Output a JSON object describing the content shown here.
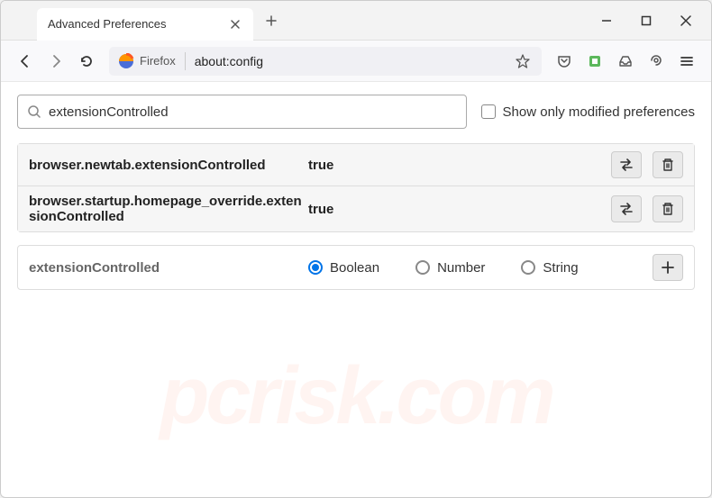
{
  "window": {
    "tab_title": "Advanced Preferences"
  },
  "toolbar": {
    "firefox_label": "Firefox",
    "url": "about:config"
  },
  "search": {
    "value": "extensionControlled",
    "modified_label": "Show only modified preferences"
  },
  "preferences": [
    {
      "name": "browser.newtab.extensionControlled",
      "value": "true"
    },
    {
      "name": "browser.startup.homepage_override.extensionControlled",
      "value": "true"
    }
  ],
  "new_pref": {
    "name": "extensionControlled",
    "types": [
      "Boolean",
      "Number",
      "String"
    ],
    "selected": "Boolean"
  },
  "watermark": "pcrisk.com"
}
